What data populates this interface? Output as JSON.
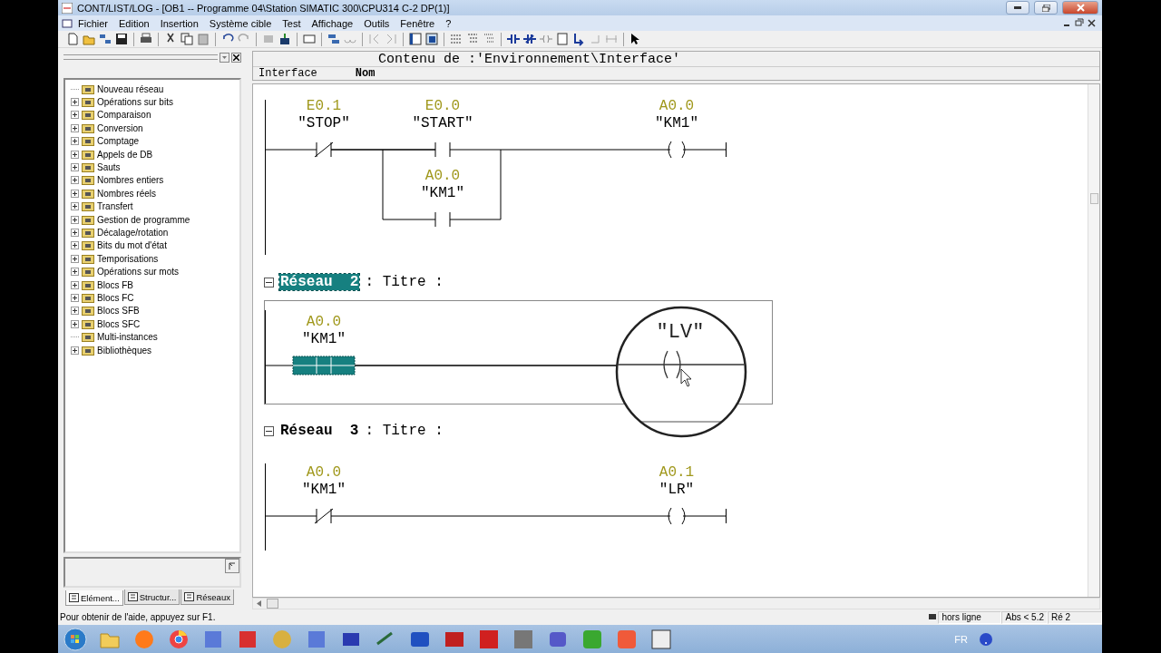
{
  "window": {
    "title": "CONT/LIST/LOG - [OB1 -- Programme 04\\Station SIMATIC 300\\CPU314 C-2 DP(1)]"
  },
  "menu": [
    "Fichier",
    "Edition",
    "Insertion",
    "Système cible",
    "Test",
    "Affichage",
    "Outils",
    "Fenêtre",
    "?"
  ],
  "sidebar": {
    "items": [
      {
        "label": "Nouveau réseau",
        "expandable": false
      },
      {
        "label": "Opérations sur bits",
        "expandable": true
      },
      {
        "label": "Comparaison",
        "expandable": true
      },
      {
        "label": "Conversion",
        "expandable": true
      },
      {
        "label": "Comptage",
        "expandable": true
      },
      {
        "label": "Appels de DB",
        "expandable": true
      },
      {
        "label": "Sauts",
        "expandable": true
      },
      {
        "label": "Nombres entiers",
        "expandable": true
      },
      {
        "label": "Nombres réels",
        "expandable": true
      },
      {
        "label": "Transfert",
        "expandable": true
      },
      {
        "label": "Gestion de programme",
        "expandable": true
      },
      {
        "label": "Décalage/rotation",
        "expandable": true
      },
      {
        "label": "Bits du mot d'état",
        "expandable": true
      },
      {
        "label": "Temporisations",
        "expandable": true
      },
      {
        "label": "Opérations sur mots",
        "expandable": true
      },
      {
        "label": "Blocs FB",
        "expandable": true
      },
      {
        "label": "Blocs FC",
        "expandable": true
      },
      {
        "label": "Blocs SFB",
        "expandable": true
      },
      {
        "label": "Blocs SFC",
        "expandable": true
      },
      {
        "label": "Multi-instances",
        "expandable": false
      },
      {
        "label": "Bibliothèques",
        "expandable": true
      }
    ],
    "tabs": [
      {
        "label": "Elément...",
        "selected": true
      },
      {
        "label": "Structur...",
        "selected": false
      },
      {
        "label": "Réseaux",
        "selected": false
      }
    ]
  },
  "interface": {
    "header": "Contenu de :'Environnement\\Interface'",
    "tree_label": "Interface",
    "column_1": "Nom"
  },
  "networks": [
    {
      "contacts": [
        {
          "kind": "nc",
          "address": "E0.1",
          "symbol": "\"STOP\"",
          "selected": false
        },
        {
          "kind": "no",
          "address": "E0.0",
          "symbol": "\"START\"",
          "selected": false,
          "parallel": {
            "kind": "no",
            "address": "A0.0",
            "symbol": "\"KM1\"",
            "selected": false
          }
        }
      ],
      "coil": {
        "address": "A0.0",
        "symbol": "\"KM1\""
      }
    },
    {
      "heading": "Réseau  2",
      "title": ": Titre :",
      "selected": true,
      "contacts": [
        {
          "kind": "no",
          "address": "A0.0",
          "symbol": "\"KM1\"",
          "selected": true
        }
      ],
      "coil": {
        "symbol": "\"LV\"",
        "magnified": true
      }
    },
    {
      "heading": "Réseau  3",
      "title": ": Titre :",
      "selected": false,
      "contacts": [
        {
          "kind": "nc",
          "address": "A0.0",
          "symbol": "\"KM1\"",
          "selected": false
        }
      ],
      "coil": {
        "address": "A0.1",
        "symbol": "\"LR\""
      }
    }
  ],
  "status": {
    "help": "Pour obtenir de l'aide, appuyez sur F1.",
    "mode": "hors ligne",
    "address": "Abs < 5.2",
    "network": "Ré 2"
  },
  "taskbar": {
    "language": "FR"
  }
}
